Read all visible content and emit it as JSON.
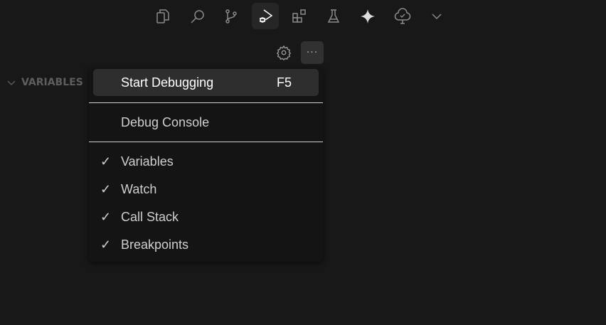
{
  "activity_bar": {
    "icons": [
      "explorer-icon",
      "search-icon",
      "source-control-icon",
      "run-debug-icon",
      "extensions-icon",
      "testing-icon",
      "copilot-icon",
      "tree-check-icon",
      "chevron-down-icon"
    ],
    "active": "run-debug-icon"
  },
  "toolbar": {
    "more_label": "···"
  },
  "section": {
    "title": "VARIABLES"
  },
  "menu": {
    "start_debugging": {
      "label": "Start Debugging",
      "shortcut": "F5"
    },
    "debug_console": {
      "label": "Debug Console"
    },
    "views": [
      {
        "label": "Variables",
        "checked": "✓"
      },
      {
        "label": "Watch",
        "checked": "✓"
      },
      {
        "label": "Call Stack",
        "checked": "✓"
      },
      {
        "label": "Breakpoints",
        "checked": "✓"
      }
    ]
  }
}
